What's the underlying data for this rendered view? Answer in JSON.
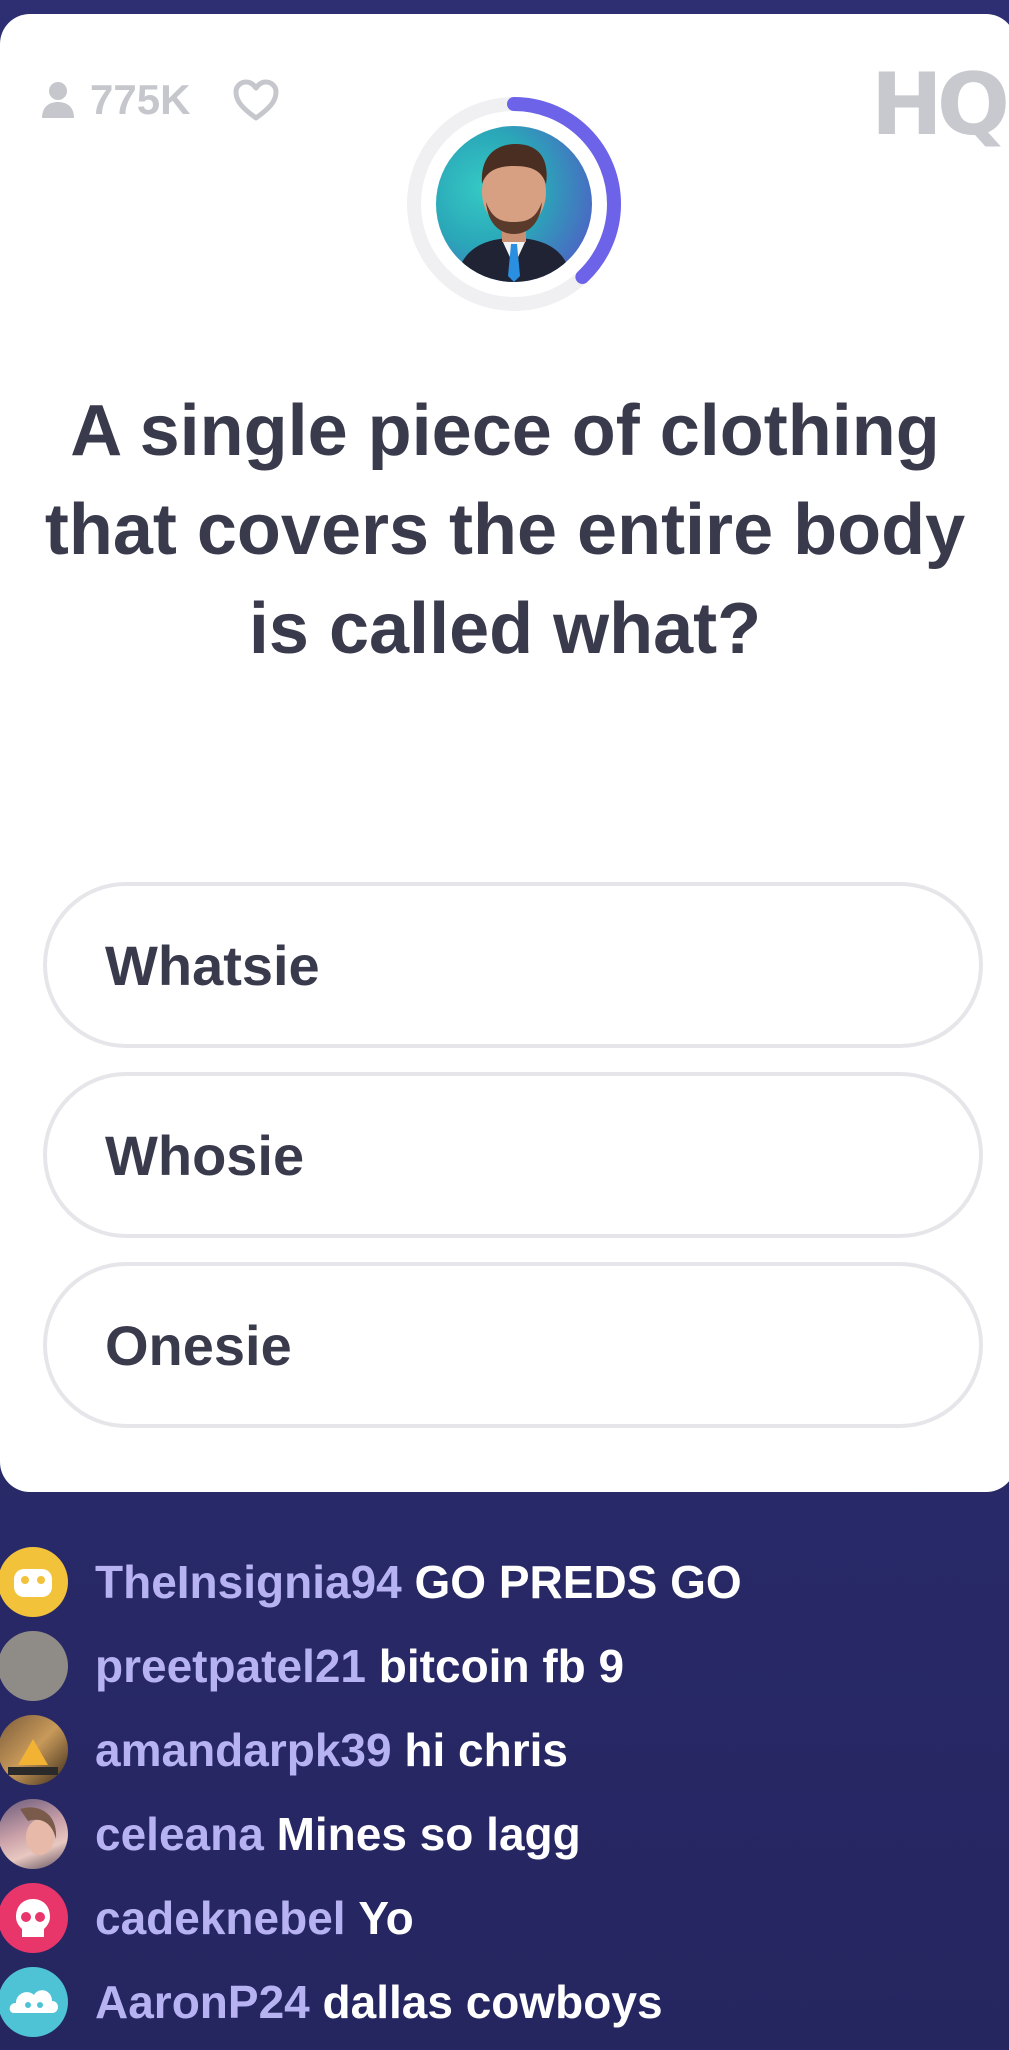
{
  "stats": {
    "viewer_count": "775K",
    "viewer_icon": "person-icon",
    "heart_icon": "heart-icon"
  },
  "brand": {
    "logo_text": "HQ"
  },
  "timer": {
    "remaining_fraction": 0.38,
    "ring_color": "#6c63e9",
    "track_color": "#f0f0f2"
  },
  "question": {
    "text": "A single piece of clothing that covers the entire body is called what?"
  },
  "answers": [
    {
      "label": "Whatsie"
    },
    {
      "label": "Whosie"
    },
    {
      "label": "Onesie"
    }
  ],
  "chat": [
    {
      "user": "TheInsignia94",
      "message": "GO PREDS GO",
      "avatar": "yellow-face-avatar"
    },
    {
      "user": "preetpatel21",
      "message": "bitcoin fb 9",
      "avatar": "gray-avatar"
    },
    {
      "user": "amandarpk39",
      "message": "hi chris",
      "avatar": "photo-avatar"
    },
    {
      "user": "celeana",
      "message": "Mines so lagg",
      "avatar": "photo-avatar"
    },
    {
      "user": "cadeknebel",
      "message": "Yo",
      "avatar": "pink-skull-avatar"
    },
    {
      "user": "AaronP24",
      "message": "dallas cowboys",
      "avatar": "teal-cloud-avatar"
    }
  ],
  "colors": {
    "background": "#2b2c6e",
    "card": "#ffffff",
    "text_dark": "#3a3a4d",
    "chat_user": "#b7b3f2"
  }
}
